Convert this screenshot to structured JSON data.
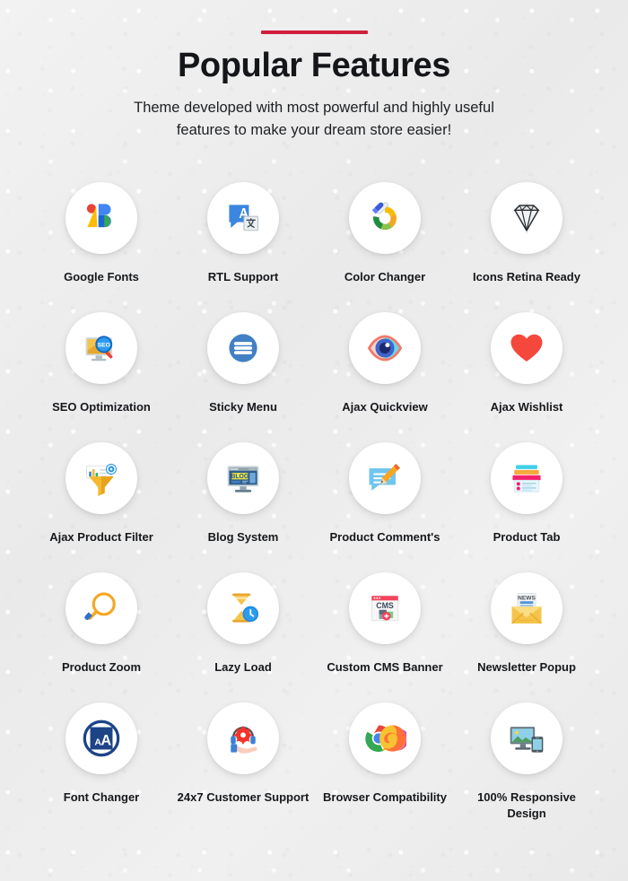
{
  "header": {
    "accent_color": "#d01f3c",
    "title": "Popular Features",
    "subtitle_line1": "Theme developed with most powerful and highly useful",
    "subtitle_line2": "features to make your dream store easier!"
  },
  "features": [
    {
      "label": "Google Fonts",
      "icon": "google-fonts-icon"
    },
    {
      "label": "RTL Support",
      "icon": "translate-icon"
    },
    {
      "label": "Color Changer",
      "icon": "eyedropper-color-wheel-icon"
    },
    {
      "label": "Icons Retina Ready",
      "icon": "diamond-icon"
    },
    {
      "label": "SEO Optimization",
      "icon": "monitor-search-seo-icon"
    },
    {
      "label": "Sticky Menu",
      "icon": "hamburger-menu-icon"
    },
    {
      "label": "Ajax Quickview",
      "icon": "eye-icon"
    },
    {
      "label": "Ajax Wishlist",
      "icon": "heart-icon"
    },
    {
      "label": "Ajax Product Filter",
      "icon": "funnel-filter-icon"
    },
    {
      "label": "Blog System",
      "icon": "blog-monitor-icon"
    },
    {
      "label": "Product Comment's",
      "icon": "comment-pencil-icon"
    },
    {
      "label": "Product Tab",
      "icon": "stacked-tabs-icon"
    },
    {
      "label": "Product Zoom",
      "icon": "magnifier-icon"
    },
    {
      "label": "Lazy Load",
      "icon": "hourglass-clock-icon"
    },
    {
      "label": "Custom CMS Banner",
      "icon": "cms-browser-icon"
    },
    {
      "label": "Newsletter Popup",
      "icon": "news-envelope-icon"
    },
    {
      "label": "Font Changer",
      "icon": "font-letter-a-icon"
    },
    {
      "label": "24x7 Customer Support",
      "icon": "headset-support-icon"
    },
    {
      "label": "Browser Compatibility",
      "icon": "browsers-chrome-firefox-icon"
    },
    {
      "label": "100% Responsive Design",
      "icon": "responsive-devices-icon"
    }
  ]
}
